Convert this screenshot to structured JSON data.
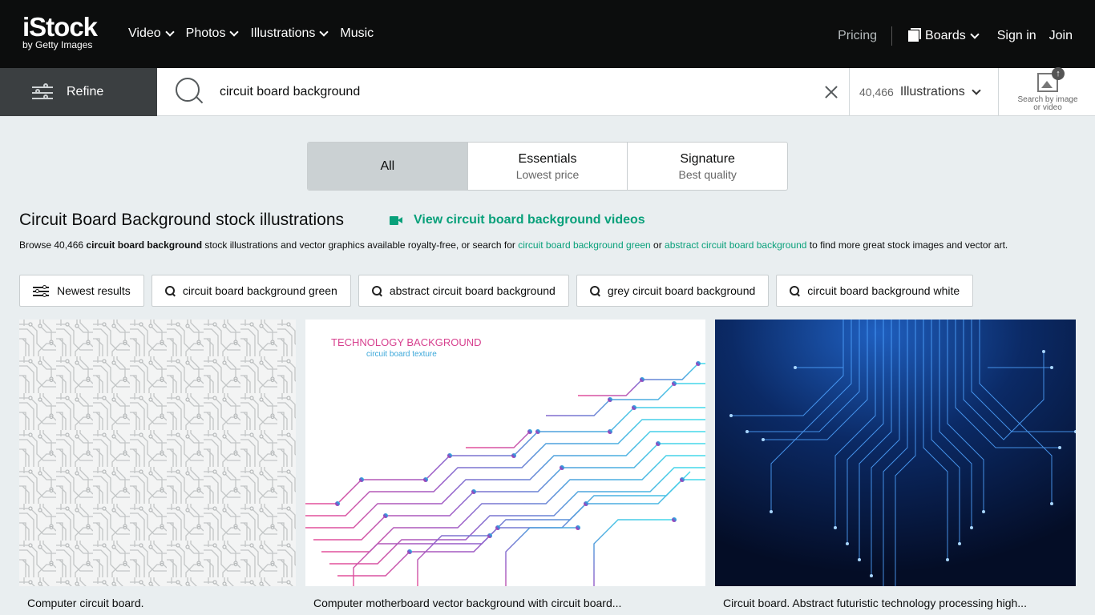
{
  "brand": {
    "name": "iStock",
    "sub": "by Getty Images"
  },
  "nav": {
    "items": [
      {
        "label": "Video"
      },
      {
        "label": "Photos"
      },
      {
        "label": "Illustrations"
      },
      {
        "label": "Music"
      }
    ],
    "pricing": "Pricing",
    "boards": "Boards",
    "signin": "Sign in",
    "join": "Join"
  },
  "search": {
    "refine_label": "Refine",
    "query": "circuit board background",
    "count": "40,466",
    "type": "Illustrations",
    "by_image_label": "Search by image or video"
  },
  "tabs": [
    {
      "title": "All",
      "subtitle": ""
    },
    {
      "title": "Essentials",
      "subtitle": "Lowest price"
    },
    {
      "title": "Signature",
      "subtitle": "Best quality"
    }
  ],
  "heading": {
    "title": "Circuit Board Background stock illustrations",
    "videos_link": "View circuit board background videos"
  },
  "description": {
    "prefix": "Browse 40,466 ",
    "bold": "circuit board background",
    "middle": " stock illustrations and vector graphics available royalty-free, or search for ",
    "link1": "circuit board background green",
    "or": " or ",
    "link2": "abstract circuit board background",
    "suffix": " to find more great stock images and vector art."
  },
  "chips": {
    "newest": "Newest results",
    "suggestions": [
      "circuit board background green",
      "abstract circuit board background",
      "grey circuit board background",
      "circuit board background white"
    ]
  },
  "results": [
    {
      "caption": "Computer circuit board.",
      "thumb_kind": "grey-circuit"
    },
    {
      "caption": "Computer motherboard vector background with circuit board...",
      "thumb_kind": "color-circuit",
      "thumb_title": "TECHNOLOGY BACKGROUND",
      "thumb_subtitle": "circuit board texture"
    },
    {
      "caption": "Circuit board. Abstract futuristic technology processing high...",
      "thumb_kind": "blue-circuit"
    }
  ],
  "colors": {
    "nav_bg": "#0c0d0d",
    "accent_green": "#08a07a",
    "page_bg": "#e9eef0",
    "refine_bg": "#3b3f41",
    "active_tab": "#cbd1d3"
  },
  "icons": [
    "sliders-icon",
    "search-icon",
    "close-icon",
    "chevron-down-icon",
    "boards-icon",
    "image-search-icon",
    "video-camera-icon"
  ]
}
